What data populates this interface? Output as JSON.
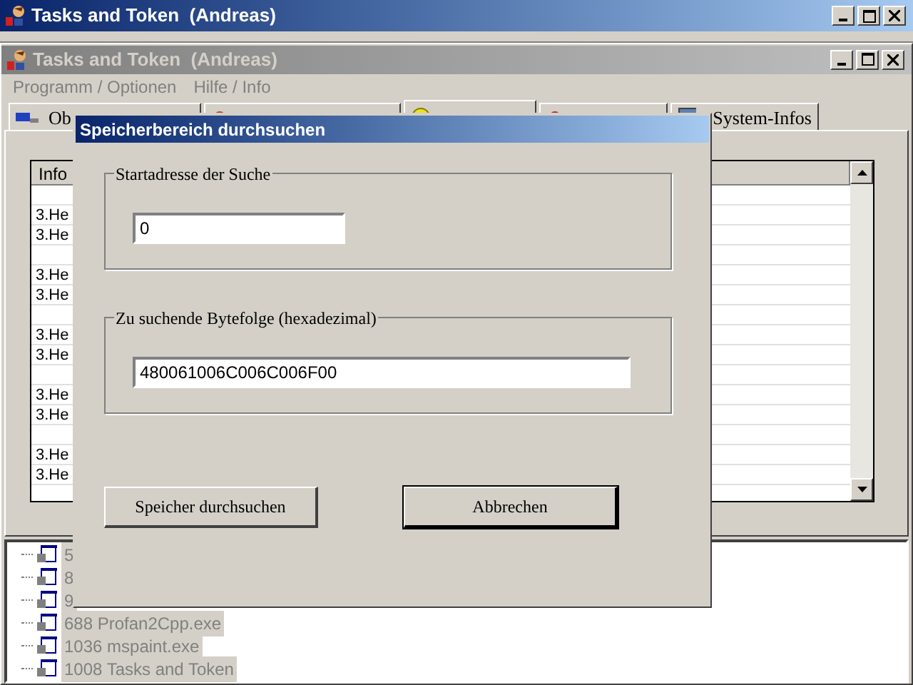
{
  "outer_window": {
    "title": "Tasks and Token  (Andreas)"
  },
  "window": {
    "title": "Tasks and Token  (Andreas)",
    "active": false
  },
  "menu": [
    "Programm / Optionen",
    "Hilfe / Info"
  ],
  "tabs": [
    {
      "label": "Ob",
      "selected": false
    },
    {
      "selected": false
    },
    {
      "selected": true
    },
    {
      "selected": false
    },
    {
      "label": "System-Infos",
      "selected": false
    }
  ],
  "list": {
    "column_1": "Info",
    "groups": [
      [
        "3.He",
        "3.He"
      ],
      [
        "3.He",
        "3.He"
      ],
      [
        "3.He",
        "3.He"
      ],
      [
        "3.He",
        "3.He"
      ],
      [
        "3.He",
        "3.He"
      ]
    ]
  },
  "tree": [
    "5",
    "8",
    "9",
    "688 Profan2Cpp.exe",
    "1036 mspaint.exe",
    "1008 Tasks and Token"
  ],
  "dialog": {
    "title": "Speicherbereich durchsuchen",
    "groups": [
      {
        "label": "Startadresse der Suche",
        "value": "0",
        "wide": false
      },
      {
        "label": "Zu suchende Bytefolge (hexadezimal)",
        "value": "480061006C006C006F00",
        "wide": true
      }
    ],
    "buttons": [
      {
        "label": "Speicher durchsuchen",
        "default": false
      },
      {
        "label": "Abbrechen",
        "default": true
      }
    ]
  }
}
